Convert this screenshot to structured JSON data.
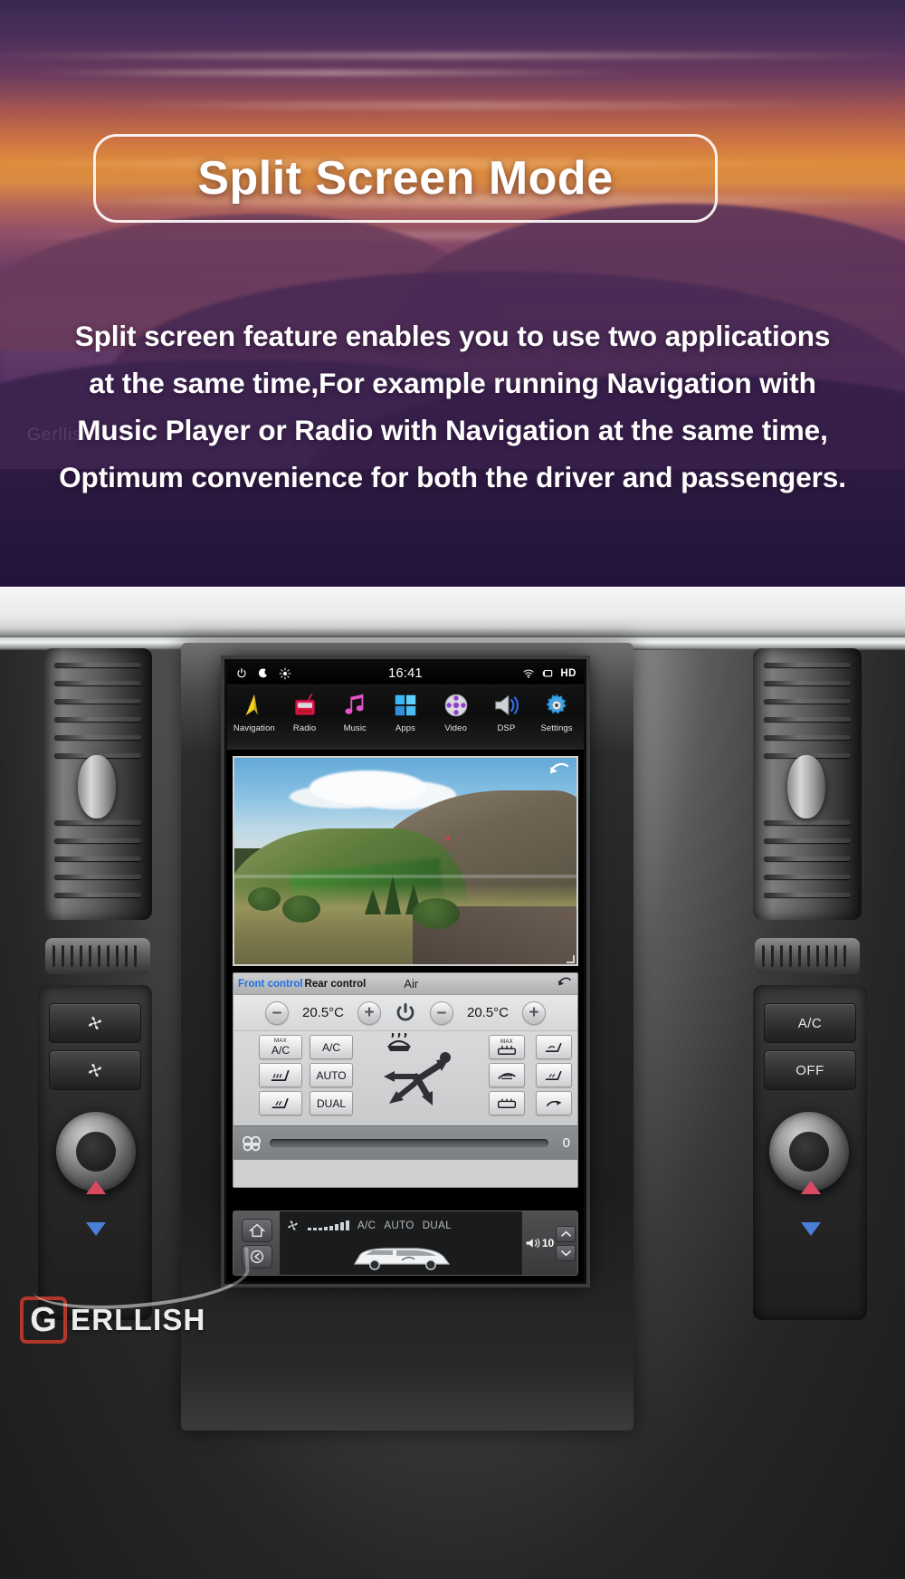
{
  "hero": {
    "title": "Split Screen Mode",
    "body_lines": [
      "Split screen feature enables you to use two applications",
      "at the same time,For example running Navigation with",
      "Music Player or Radio with Navigation at the same time,",
      "Optimum convenience for both the driver and passengers."
    ],
    "ghost_text": "Gerllish"
  },
  "watermark": {
    "mark": "G",
    "word": "ERLLISH"
  },
  "stereo": {
    "status_bar": {
      "icons": [
        "power-icon",
        "night-mode-icon",
        "brightness-icon"
      ],
      "clock": "16:41",
      "right_icons": [
        "wifi-icon",
        "screen-cast-icon"
      ],
      "hd_label": "HD"
    },
    "launcher": [
      {
        "label": "Navigation",
        "icon": "navigation-arrow-icon"
      },
      {
        "label": "Radio",
        "icon": "radio-icon"
      },
      {
        "label": "Music",
        "icon": "music-note-icon"
      },
      {
        "label": "Apps",
        "icon": "apps-grid-icon"
      },
      {
        "label": "Video",
        "icon": "film-reel-icon"
      },
      {
        "label": "DSP",
        "icon": "speaker-icon"
      },
      {
        "label": "Settings",
        "icon": "gear-icon"
      }
    ],
    "top_pane": {
      "name": "navigation-camera-view",
      "back_icon": "back-arrow-icon",
      "resize_icon": "resize-handle-icon"
    },
    "climate": {
      "tabs": [
        {
          "label": "Front control",
          "active": true
        },
        {
          "label": "Rear control",
          "active": false
        }
      ],
      "air_label": "Air",
      "undo_icon": "undo-arrow-icon",
      "left_temp": "20.5°C",
      "right_temp": "20.5°C",
      "minus_label": "–",
      "plus_label": "+",
      "power_icon": "power-icon",
      "buttons_left": [
        {
          "label": "A/C",
          "sup": "MAX",
          "name": "max-ac-button"
        },
        {
          "label": "A/C",
          "sup": "",
          "name": "ac-button"
        },
        {
          "label": "",
          "sup": "",
          "name": "front-seat-heat-icon-button"
        },
        {
          "label": "AUTO",
          "sup": "",
          "name": "auto-button"
        },
        {
          "label": "",
          "sup": "",
          "name": "seat-heat-icon-button"
        },
        {
          "label": "DUAL",
          "sup": "",
          "name": "dual-button"
        }
      ],
      "buttons_right": [
        {
          "label": "",
          "sup": "MAX",
          "name": "max-defrost-button"
        },
        {
          "label": "",
          "sup": "",
          "name": "rear-seat-heat-button"
        },
        {
          "label": "",
          "sup": "",
          "name": "recirculation-button"
        },
        {
          "label": "",
          "sup": "",
          "name": "seat-vent-button"
        },
        {
          "label": "",
          "sup": "",
          "name": "rear-defrost-button"
        }
      ],
      "fan_icon": "fan-icon",
      "fan_value": "0"
    },
    "system_bar": {
      "home_icon": "home-icon",
      "back_icon": "back-arrow-icon",
      "fan_icon": "fan-blade-icon",
      "status_labels": [
        "A/C",
        "AUTO",
        "DUAL"
      ],
      "bar_levels": [
        3,
        3,
        3,
        4,
        5,
        7,
        9,
        11
      ],
      "volume_icon": "volume-icon",
      "volume_value": "10",
      "vol_up_icon": "chevron-up-icon",
      "vol_down_icon": "chevron-down-icon",
      "car_icon": "suv-airflow-icon"
    }
  },
  "dashboard": {
    "left_buttons": [
      "fan-icon",
      "rear-fan-icon"
    ],
    "right_buttons": [
      {
        "label": "A/C"
      },
      {
        "label": "OFF"
      }
    ],
    "rotary_left": "temp-rotary-knob",
    "rotary_right": "volume-rotary-knob"
  },
  "colors": {
    "accent_blue": "#1e6fe0",
    "title_white": "#ffffff",
    "screen_black": "#000000",
    "brand_red": "#c0392b"
  }
}
